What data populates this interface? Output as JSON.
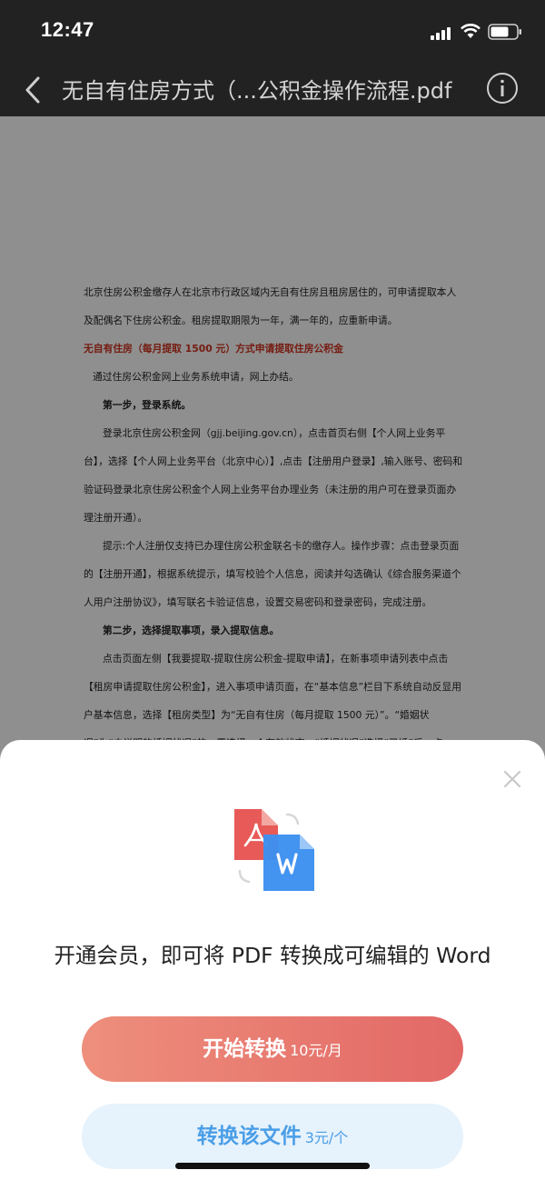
{
  "status_bar": {
    "time": "12:47"
  },
  "nav": {
    "title": "无自有住房方式（...公积金操作流程.pdf"
  },
  "document": {
    "paragraphs": [
      "北京住房公积金缴存人在北京市行政区域内无自有住房且租房居住的，可申请提取本人及配偶名下住房公积金。租房提取期限为一年，满一年的，应重新申请。",
      "无自有住房（每月提取 1500 元）方式申请提取住房公积金",
      "通过住房公积金网上业务系统申请，网上办结。",
      "第一步，登录系统。",
      "登录北京住房公积金网（gjj.beijing.gov.cn），点击首页右侧【个人网上业务平台】，选择【个人网上业务平台（北京中心）】,点击【注册用户登录】,输入账号、密码和验证码登录北京住房公积金个人网上业务平台办理业务（未注册的用户可在登录页面办理注册开通）。",
      "提示:个人注册仅支持已办理住房公积金联名卡的缴存人。操作步骤：点击登录页面的【注册开通】，根据系统提示，填写校验个人信息，阅读并勾选确认《综合服务渠道个人用户注册协议》，填写联名卡验证信息，设置交易密码和登录密码，完成注册。",
      "第二步，选择提取事项，录入提取信息。",
      "点击页面左侧【我要提取-提取住房公积金-提取申请】，在新事项申请列表中点击【租房申请提取住房公积金】，进入事项申请页面，在“基本信息”栏目下系统自动反显用户基本信息，选择【租房类型】为“无自有住房（每月提取 1500 元）”。“婚姻状况”为“未说明的婚姻状况”的，需选择一个有效状态。“婚姻状况”选择“已婚”后，点击“婚姻信息修改”按钮后，系统通过北京市民政系统进行校验，查询已登记婚姻，备记录系统自动回填，无"
    ]
  },
  "sheet": {
    "promo": "开通会员，即可将 PDF 转换成可编辑的 Word",
    "start_button": {
      "label": "开始转换",
      "price": "10元/月"
    },
    "file_button": {
      "label": "转换该文件",
      "price": "3元/个"
    }
  },
  "colors": {
    "accent_red": "#e26866",
    "accent_blue": "#4a9ee7",
    "pdf_red": "#e85a57",
    "word_blue": "#3d8ff0"
  },
  "icons": {
    "back": "chevron-left-icon",
    "info": "info-icon",
    "close": "close-icon",
    "pdf": "pdf-file-icon",
    "word": "word-file-icon"
  }
}
